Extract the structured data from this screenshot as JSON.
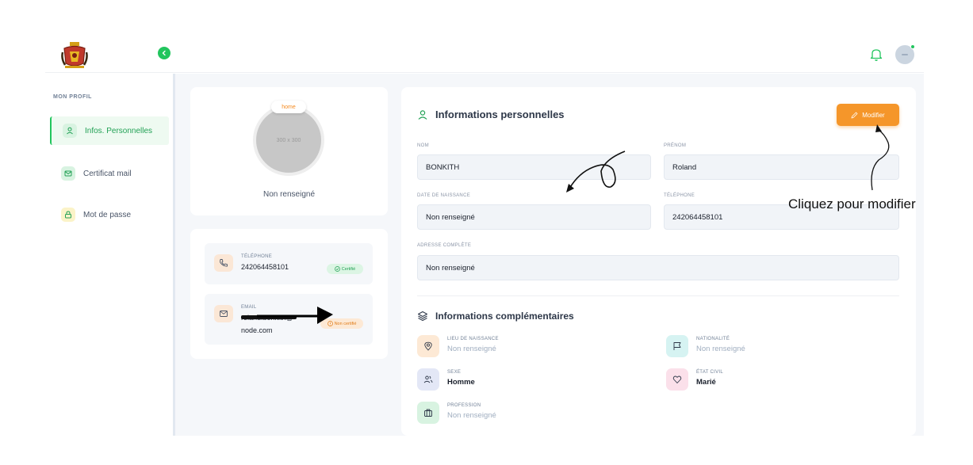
{
  "header": {
    "logo_icon": "coat-of-arms-logo",
    "collapse_icon": "chevron-left-icon",
    "notification_icon": "bell-icon",
    "avatar_icon": "user-avatar"
  },
  "sidebar": {
    "title": "MON PROFIL",
    "items": [
      {
        "label": "Infos. Personnelles",
        "icon": "user-icon",
        "active": true
      },
      {
        "label": "Certificat mail",
        "icon": "mail-icon",
        "active": false
      },
      {
        "label": "Mot de passe",
        "icon": "lock-icon",
        "active": false
      }
    ]
  },
  "profile": {
    "badge": "home",
    "photo_placeholder": "300 x 300",
    "name": "Non renseigné"
  },
  "contacts": {
    "phone": {
      "label": "TÉLÉPHONE",
      "value": "242064458101",
      "status": "Certifié"
    },
    "email": {
      "label": "EMAIL",
      "value_line1": "roland.bonkith@",
      "value_line2": "node.com",
      "status": "Non certifié"
    }
  },
  "personal": {
    "title": "Informations personnelles",
    "modify_label": "Modifier",
    "fields": {
      "nom": {
        "label": "NOM",
        "value": "BONKITH"
      },
      "prenom": {
        "label": "PRÉNOM",
        "value": "Roland"
      },
      "naissance": {
        "label": "DATE DE NAISSANCE",
        "value": "Non renseigné"
      },
      "telephone": {
        "label": "TÉLÉPHONE",
        "value": "242064458101"
      },
      "adresse": {
        "label": "ADRESSE COMPLÈTE",
        "value": "Non renseigné"
      }
    }
  },
  "complementary": {
    "title": "Informations complémentaires",
    "items": {
      "lieu": {
        "label": "LIEU DE NAISSANCE",
        "value": "Non renseigné"
      },
      "nationalite": {
        "label": "NATIONALITÉ",
        "value": "Non renseigné"
      },
      "sexe": {
        "label": "SEXE",
        "value": "Homme"
      },
      "etat_civil": {
        "label": "ÉTAT CIVIL",
        "value": "Marié"
      },
      "profession": {
        "label": "PROFESSION",
        "value": "Non renseigné"
      }
    }
  },
  "annotation": {
    "text": "Cliquez pour modifier"
  },
  "colors": {
    "accent_green": "#22c55e",
    "accent_orange": "#f5962a",
    "background": "#f5f7fa"
  }
}
